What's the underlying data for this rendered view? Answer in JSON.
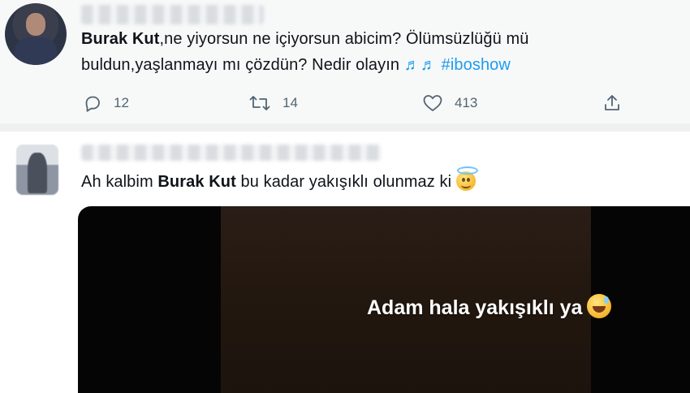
{
  "tweet1": {
    "author": "Burak Kut",
    "line1_rest": ",ne yiyorsun ne içiyorsun abicim? Ölümsüzlüğü mü",
    "line2": "buldun,yaşlanmayı mı çözdün? Nedir olayın",
    "notes": "♬♬",
    "hashtag": "#iboshow",
    "actions": {
      "reply_count": "12",
      "retweet_count": "14",
      "like_count": "413"
    },
    "icons": [
      "reply-icon",
      "retweet-icon",
      "like-icon",
      "share-icon"
    ]
  },
  "tweet2": {
    "text_before": "Ah kalbim ",
    "author": "Burak Kut",
    "text_after": " bu kadar yakışıklı olunmaz ki",
    "emoji": "smiling-face-with-halo",
    "media_caption": "Adam hala yakışıklı ya",
    "media_emoji": "grinning-face-with-sweat"
  },
  "colors": {
    "accent": "#1d9bf0",
    "text": "#0f1419",
    "secondary": "#536471"
  }
}
